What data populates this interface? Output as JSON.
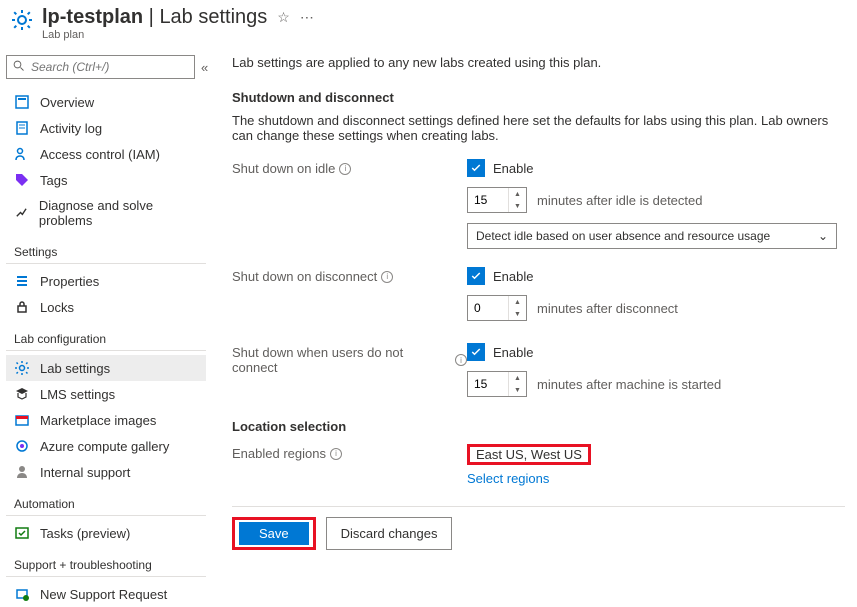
{
  "header": {
    "title_main": "lp-testplan",
    "title_sep": " | ",
    "title_page": "Lab settings",
    "subtitle": "Lab plan"
  },
  "sidebar": {
    "search_placeholder": "Search (Ctrl+/)",
    "items": {
      "overview": "Overview",
      "activity": "Activity log",
      "access": "Access control (IAM)",
      "tags": "Tags",
      "diagnose": "Diagnose and solve problems"
    },
    "group_settings": "Settings",
    "settings": {
      "properties": "Properties",
      "locks": "Locks"
    },
    "group_labconfig": "Lab configuration",
    "labconfig": {
      "labsettings": "Lab settings",
      "lms": "LMS settings",
      "marketplace": "Marketplace images",
      "compute": "Azure compute gallery",
      "support": "Internal support"
    },
    "group_automation": "Automation",
    "automation": {
      "tasks": "Tasks (preview)"
    },
    "group_support": "Support + troubleshooting",
    "support": {
      "newreq": "New Support Request"
    }
  },
  "main": {
    "intro": "Lab settings are applied to any new labs created using this plan.",
    "shutdown_head": "Shutdown and disconnect",
    "shutdown_desc": "The shutdown and disconnect settings defined here set the defaults for labs using this plan. Lab owners can change these settings when creating labs.",
    "idle_label": "Shut down on idle",
    "enable_label": "Enable",
    "idle_minutes": "15",
    "idle_aux": "minutes after idle is detected",
    "idle_dropdown": "Detect idle based on user absence and resource usage",
    "disconnect_label": "Shut down on disconnect",
    "disconnect_minutes": "0",
    "disconnect_aux": "minutes after disconnect",
    "noconnect_label": "Shut down when users do not connect",
    "noconnect_minutes": "15",
    "noconnect_aux": "minutes after machine is started",
    "location_head": "Location selection",
    "regions_label": "Enabled regions",
    "regions_value": "East US, West US",
    "regions_link": "Select regions",
    "save": "Save",
    "discard": "Discard changes"
  }
}
